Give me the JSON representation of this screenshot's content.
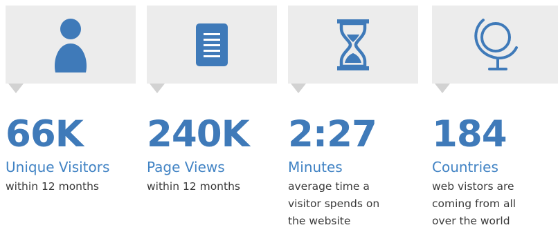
{
  "accent_color": "#3f7ab9",
  "stats": [
    {
      "icon": "user-icon",
      "value": "66K",
      "title": "Unique Visitors",
      "description": "within 12 months"
    },
    {
      "icon": "document-icon",
      "value": "240K",
      "title": "Page Views",
      "description": "within 12 months"
    },
    {
      "icon": "hourglass-icon",
      "value": "2:27",
      "title": "Minutes",
      "description": "average time a\nvisitor spends on\nthe website"
    },
    {
      "icon": "globe-icon",
      "value": "184",
      "title": "Countries",
      "description": "web vistors are\ncoming from all\nover the world"
    }
  ]
}
